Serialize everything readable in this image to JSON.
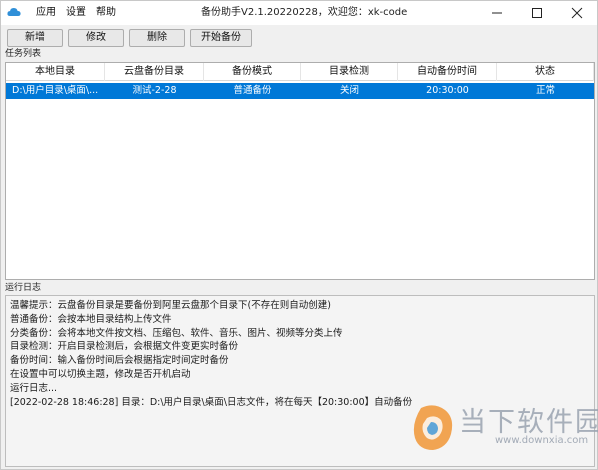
{
  "window": {
    "title": "备份助手V2.1.20220228，欢迎您：xk-code"
  },
  "menu": {
    "items": [
      {
        "label": "应用"
      },
      {
        "label": "设置"
      },
      {
        "label": "帮助"
      }
    ]
  },
  "toolbar": {
    "add_label": "新增",
    "edit_label": "修改",
    "delete_label": "删除",
    "start_label": "开始备份"
  },
  "tasks": {
    "section_label": "任务列表",
    "columns": [
      "本地目录",
      "云盘备份目录",
      "备份模式",
      "目录检测",
      "自动备份时间",
      "状态"
    ],
    "rows": [
      {
        "local_dir": "D:\\用户目录\\桌面\\...",
        "cloud_dir": "测试-2-28",
        "mode": "普通备份",
        "detect": "关闭",
        "time": "20:30:00",
        "status": "正常",
        "selected": true
      }
    ]
  },
  "log": {
    "section_label": "运行日志",
    "lines": [
      "温馨提示：云盘备份目录是要备份到阿里云盘那个目录下(不存在则自动创建)",
      "普通备份：会按本地目录结构上传文件",
      "分类备份：会将本地文件按文档、压缩包、软件、音乐、图片、视频等分类上传",
      "目录检测：开启目录检测后，会根据文件变更实时备份",
      "备份时间：输入备份时间后会根据指定时间定时备份",
      "在设置中可以切换主题，修改是否开机启动",
      "运行日志...",
      "[2022-02-28 18:46:28] 目录：D:\\用户目录\\桌面\\日志文件，将在每天【20:30:00】自动备份"
    ]
  },
  "watermark": {
    "title": "当下软件园",
    "url": "www.downxia.com"
  },
  "colors": {
    "selection": "#0078d7",
    "app_icon": "#2f8fd8",
    "watermark": "#9aa3b0"
  }
}
